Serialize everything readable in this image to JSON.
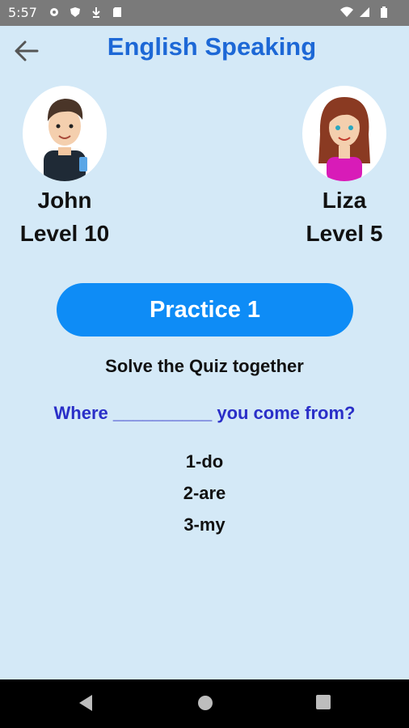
{
  "status": {
    "time": "5:57"
  },
  "header": {
    "title": "English Speaking"
  },
  "players": [
    {
      "name": "John",
      "level": "Level 10"
    },
    {
      "name": "Liza",
      "level": "Level 5"
    }
  ],
  "practice": {
    "label": "Practice 1"
  },
  "quiz": {
    "instruction": "Solve the Quiz together",
    "question": "Where __________ you come from?",
    "options": [
      "1-do",
      "2-are",
      "3-my"
    ]
  },
  "colors": {
    "background": "#d4e9f7",
    "accent": "#0e8cf6",
    "title": "#1d68d6",
    "question": "#2a2fc8"
  },
  "icons": {
    "back": "arrow-left-icon",
    "nav": [
      "nav-back-icon",
      "nav-home-icon",
      "nav-recents-icon"
    ]
  }
}
